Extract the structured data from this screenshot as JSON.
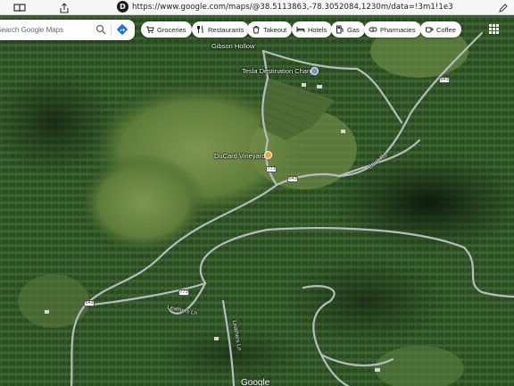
{
  "browser": {
    "url": "https://www.google.com/maps/@38.5113863,-78.3052084,1230m/data=!3m1!1e3",
    "favicon_letter": "D",
    "icons": [
      "book-icon",
      "share-icon",
      "edit-icon"
    ]
  },
  "search": {
    "placeholder": "Search Google Maps",
    "search_icon": "search-icon",
    "directions_icon": "directions-icon"
  },
  "chips": [
    {
      "label": "Groceries",
      "icon": "cart-icon"
    },
    {
      "label": "Restaurants",
      "icon": "fork-knife-icon"
    },
    {
      "label": "Takeout",
      "icon": "takeout-icon"
    },
    {
      "label": "Hotels",
      "icon": "bed-icon"
    },
    {
      "label": "Gas",
      "icon": "gas-pump-icon"
    },
    {
      "label": "Pharmacies",
      "icon": "pill-icon"
    },
    {
      "label": "Coffee",
      "icon": "coffee-cup-icon"
    }
  ],
  "map": {
    "places": [
      {
        "name": "Gibson Hollow"
      },
      {
        "name": "Tesla Destination Charger"
      },
      {
        "name": "DuCard Vineyards"
      }
    ],
    "roads": [
      "Etlan Rd",
      "Leathers Ln",
      "Leathers Ln"
    ],
    "shields": [
      "643",
      "643",
      "643",
      "773",
      "773"
    ],
    "attribution": "Google"
  },
  "colors": {
    "forest": "#2a4a22",
    "field": "#6f8a46",
    "road": "#b8bcc0",
    "charger_pin": "#7b8fd6",
    "winery_pin": "#f2a33a"
  }
}
